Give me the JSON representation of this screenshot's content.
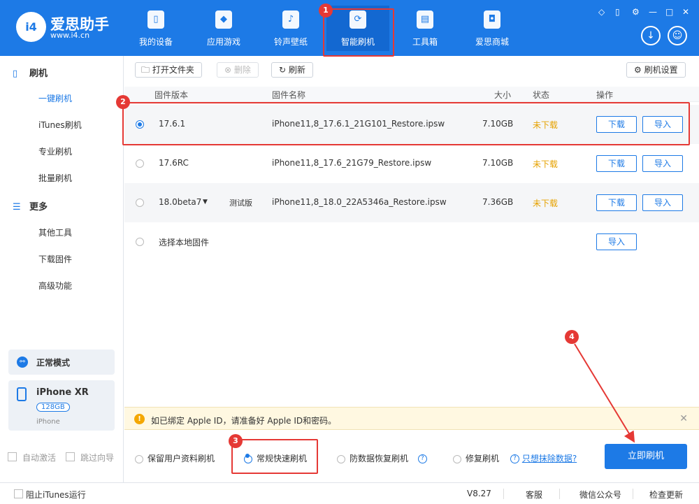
{
  "app": {
    "name": "爱思助手",
    "url": "www.i4.cn",
    "logo_text": "i4"
  },
  "nav": [
    {
      "label": "我的设备",
      "icon": "phone-icon"
    },
    {
      "label": "应用游戏",
      "icon": "cube-icon"
    },
    {
      "label": "铃声壁纸",
      "icon": "music-folder-icon"
    },
    {
      "label": "智能刷机",
      "icon": "refresh-shield-icon",
      "active": true
    },
    {
      "label": "工具箱",
      "icon": "toolbox-icon"
    },
    {
      "label": "爱思商城",
      "icon": "shopping-bag-icon"
    }
  ],
  "sidebar": {
    "section1": {
      "title": "刷机",
      "icon": "phone-icon"
    },
    "items1": [
      {
        "label": "一键刷机",
        "active": true
      },
      {
        "label": "iTunes刷机"
      },
      {
        "label": "专业刷机"
      },
      {
        "label": "批量刷机"
      }
    ],
    "section2": {
      "title": "更多",
      "icon": "menu-icon"
    },
    "items2": [
      {
        "label": "其他工具"
      },
      {
        "label": "下载固件"
      },
      {
        "label": "高级功能"
      }
    ],
    "mode": "正常模式",
    "device": {
      "name": "iPhone XR",
      "storage": "128GB",
      "type": "iPhone"
    },
    "auto_activate": "自动激活",
    "skip_guide": "跳过向导"
  },
  "toolbar": {
    "open_folder": "打开文件夹",
    "delete": "删除",
    "refresh": "刷新",
    "settings": "刷机设置"
  },
  "table": {
    "headers": {
      "version": "固件版本",
      "name": "固件名称",
      "size": "大小",
      "status": "状态",
      "action": "操作"
    },
    "rows": [
      {
        "version": "17.6.1",
        "name": "iPhone11,8_17.6.1_21G101_Restore.ipsw",
        "size": "7.10GB",
        "status": "未下载",
        "download": "下载",
        "import": "导入",
        "selected": true
      },
      {
        "version": "17.6RC",
        "name": "iPhone11,8_17.6_21G79_Restore.ipsw",
        "size": "7.10GB",
        "status": "未下载",
        "download": "下载",
        "import": "导入"
      },
      {
        "version": "18.0beta7",
        "tag": "测试版",
        "name": "iPhone11,8_18.0_22A5346a_Restore.ipsw",
        "size": "7.36GB",
        "status": "未下载",
        "download": "下载",
        "import": "导入"
      }
    ],
    "local": {
      "label": "选择本地固件",
      "import": "导入"
    }
  },
  "notice": "如已绑定 Apple ID，请准备好 Apple ID和密码。",
  "options": {
    "keep_data": "保留用户资料刷机",
    "quick": "常规快速刷机",
    "anti_recovery": "防数据恢复刷机",
    "repair": "修复刷机",
    "erase_link": "只想抹除数据?"
  },
  "flash_button": "立即刷机",
  "footer": {
    "block_itunes": "阻止iTunes运行",
    "version": "V8.27",
    "support": "客服",
    "wechat": "微信公众号",
    "update": "检查更新"
  },
  "annotations": [
    "1",
    "2",
    "3",
    "4"
  ],
  "colors": {
    "brand": "#1d7ae6",
    "status": "#e6a200",
    "highlight": "#e53935"
  }
}
